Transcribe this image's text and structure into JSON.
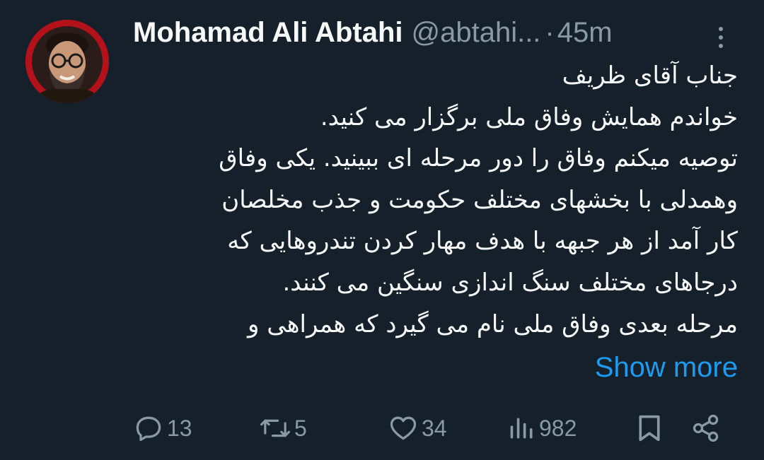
{
  "author": {
    "name": "Mohamad Ali Abtahi",
    "handle": "@abtahi...",
    "separator": "·",
    "time": "45m"
  },
  "tweet": {
    "lines": [
      "جناب آقای ظریف",
      "خواندم همایش وفاق ملی برگزار می کنید.",
      " توصیه میکنم وفاق را دور مرحله ای ببینید. یکی وفاق",
      "وهمدلی با بخشهای مختلف حکومت و جذب مخلصان",
      "کار آمد از هر جبهه با هدف مهار کردن تندروهایی که",
      "درجاهای مختلف سنگ اندازی سنگین می کنند.",
      "مرحله بعدی وفاق ملی نام می گیرد که همراهی و"
    ],
    "show_more": "Show more"
  },
  "actions": {
    "replies": "13",
    "reposts": "5",
    "likes": "34",
    "views": "982"
  },
  "icons": {
    "reply": "reply-icon",
    "repost": "repost-icon",
    "like": "heart-icon",
    "views": "views-chart-icon",
    "bookmark": "bookmark-icon",
    "share": "share-icon",
    "more": "more-vertical-icon"
  },
  "colors": {
    "background": "#15202b",
    "text": "#f7f9f9",
    "secondary": "#8b98a5",
    "link": "#1d9bf0",
    "avatar_ring": "#c0141e"
  }
}
